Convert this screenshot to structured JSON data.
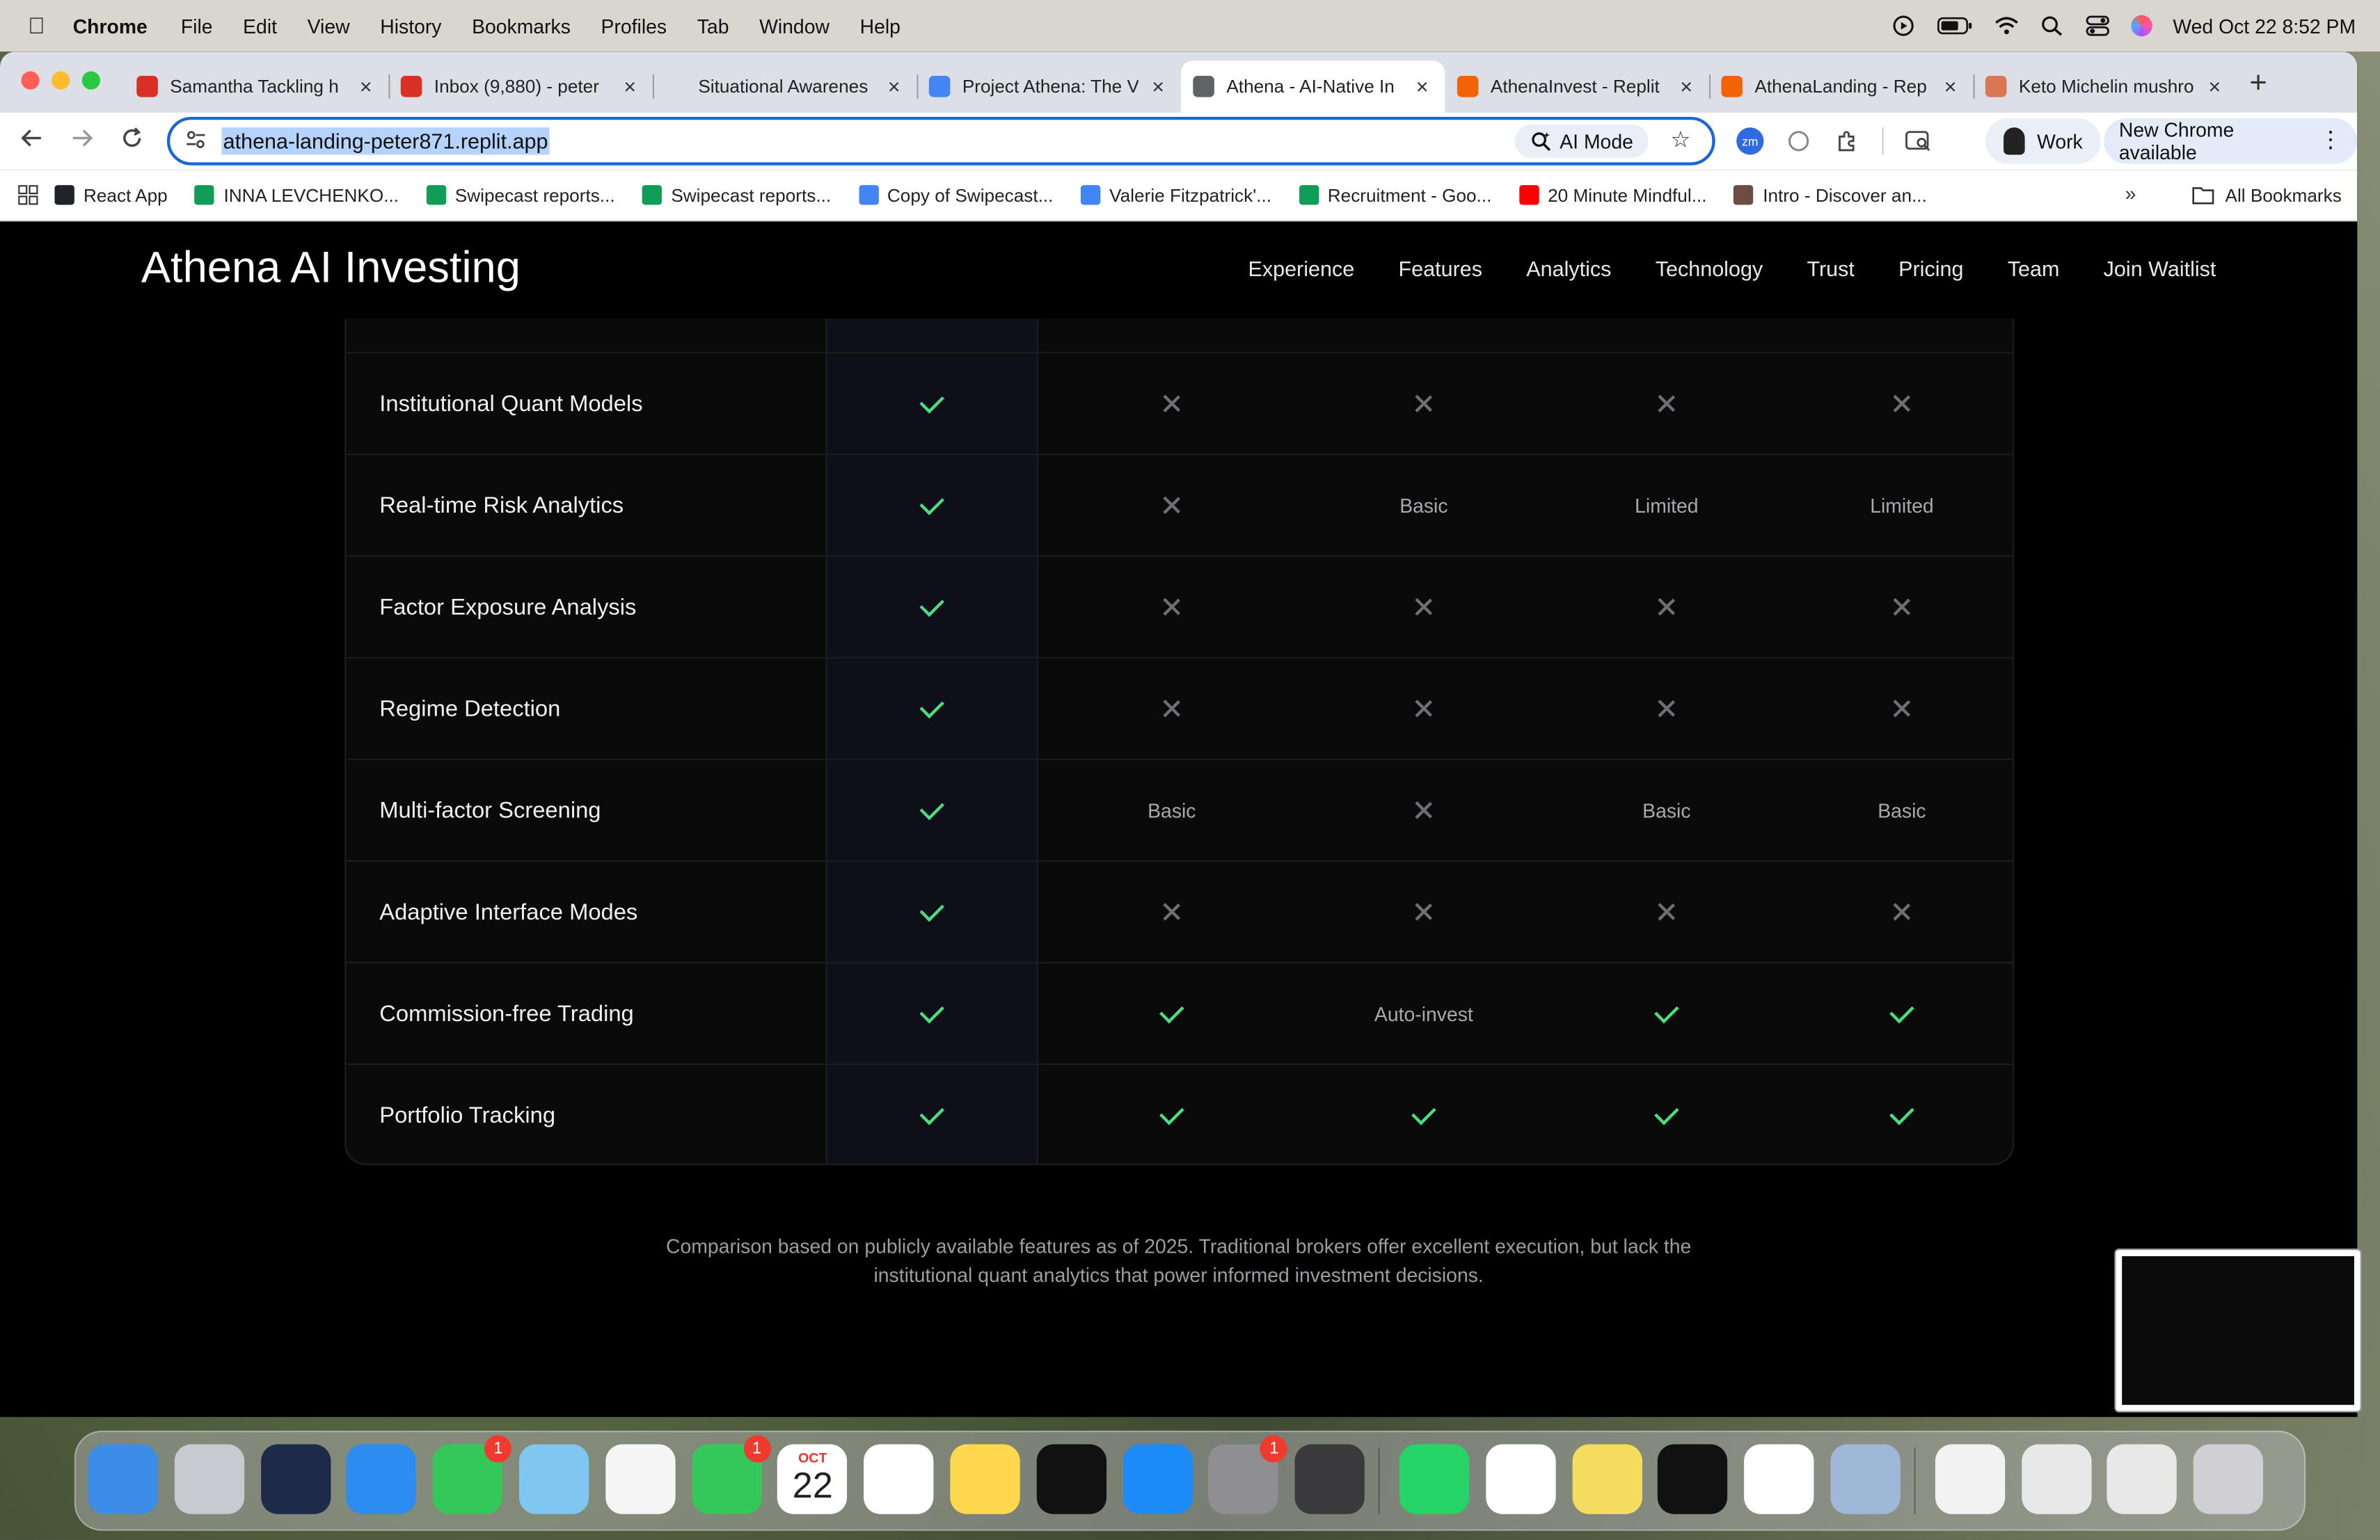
{
  "menubar": {
    "app": "Chrome",
    "items": [
      "File",
      "Edit",
      "View",
      "History",
      "Bookmarks",
      "Profiles",
      "Tab",
      "Window",
      "Help"
    ],
    "datetime": "Wed Oct 22  8:52 PM"
  },
  "tabs": [
    {
      "title": "Samantha Tackling h",
      "color": "#d93025"
    },
    {
      "title": "Inbox (9,880) - peter",
      "color": "#d93025"
    },
    {
      "title": "Situational Awarenes",
      "color": "#dcdfe6"
    },
    {
      "title": "Project Athena: The V",
      "color": "#4285f4"
    },
    {
      "title": "Athena - AI-Native In",
      "color": "#5f6368"
    },
    {
      "title": "AthenaInvest - Replit",
      "color": "#f26207"
    },
    {
      "title": "AthenaLanding - Rep",
      "color": "#f26207"
    },
    {
      "title": "Keto Michelin mushro",
      "color": "#d97757"
    }
  ],
  "active_tab_index": 4,
  "address_bar": {
    "url": "athena-landing-peter871.replit.app",
    "ai_mode": "AI Mode"
  },
  "profile": {
    "label": "Work"
  },
  "update_button": {
    "label": "New Chrome available"
  },
  "bookmarks": [
    {
      "label": "React App",
      "color": "#20232a"
    },
    {
      "label": "INNA LEVCHENKO...",
      "color": "#0f9d58"
    },
    {
      "label": "Swipecast reports...",
      "color": "#0f9d58"
    },
    {
      "label": "Swipecast reports...",
      "color": "#0f9d58"
    },
    {
      "label": "Copy of Swipecast...",
      "color": "#4285f4"
    },
    {
      "label": "Valerie Fitzpatrick'...",
      "color": "#4285f4"
    },
    {
      "label": "Recruitment - Goo...",
      "color": "#0f9d58"
    },
    {
      "label": "20 Minute Mindful...",
      "color": "#ff0000"
    },
    {
      "label": "Intro - Discover an...",
      "color": "#6d4c41"
    }
  ],
  "bookmarks_all": "All Bookmarks",
  "site": {
    "brand": "Athena AI Investing",
    "nav": [
      "Experience",
      "Features",
      "Analytics",
      "Technology",
      "Trust",
      "Pricing",
      "Team",
      "Join Waitlist"
    ]
  },
  "comparison": {
    "rows": [
      {
        "feature": "Institutional Quant Models",
        "cells": [
          "check",
          "x",
          "x",
          "x",
          "x"
        ]
      },
      {
        "feature": "Real-time Risk Analytics",
        "cells": [
          "check",
          "x",
          "Basic",
          "Limited",
          "Limited"
        ]
      },
      {
        "feature": "Factor Exposure Analysis",
        "cells": [
          "check",
          "x",
          "x",
          "x",
          "x"
        ]
      },
      {
        "feature": "Regime Detection",
        "cells": [
          "check",
          "x",
          "x",
          "x",
          "x"
        ]
      },
      {
        "feature": "Multi-factor Screening",
        "cells": [
          "check",
          "Basic",
          "x",
          "Basic",
          "Basic"
        ]
      },
      {
        "feature": "Adaptive Interface Modes",
        "cells": [
          "check",
          "x",
          "x",
          "x",
          "x"
        ]
      },
      {
        "feature": "Commission-free Trading",
        "cells": [
          "check",
          "check",
          "Auto-invest",
          "check",
          "check"
        ]
      },
      {
        "feature": "Portfolio Tracking",
        "cells": [
          "check",
          "check",
          "check",
          "check",
          "check"
        ]
      }
    ],
    "footnote": "Comparison based on publicly available features as of 2025. Traditional brokers offer excellent execution, but lack the institutional quant analytics that power informed investment decisions."
  },
  "dock": {
    "apps": [
      {
        "name": "finder-icon",
        "color": "#3b8de8"
      },
      {
        "name": "launchpad-icon",
        "color": "#c9c9d0"
      },
      {
        "name": "copilot-icon",
        "color": "#1e2a4a"
      },
      {
        "name": "safari-icon",
        "color": "#2d8cf0"
      },
      {
        "name": "messages-icon",
        "color": "#34c759",
        "badge": "1"
      },
      {
        "name": "maps-icon",
        "color": "#7fc6f0"
      },
      {
        "name": "photos-icon",
        "color": "#f5f5f5"
      },
      {
        "name": "facetime-icon",
        "color": "#34c759",
        "badge": "1"
      },
      {
        "name": "calendar-icon",
        "color": "#ffffff",
        "month": "OCT",
        "day": "22"
      },
      {
        "name": "reminders-icon",
        "color": "#ffffff"
      },
      {
        "name": "notes-icon",
        "color": "#ffd84d"
      },
      {
        "name": "appletv-icon",
        "color": "#111111"
      },
      {
        "name": "appstore-icon",
        "color": "#1d8cf8"
      },
      {
        "name": "settings-icon",
        "color": "#8e8e93",
        "badge": "1"
      },
      {
        "name": "iphone-mirroring-icon",
        "color": "#3a3a3c"
      },
      {
        "name": "whatsapp-icon",
        "color": "#25d366"
      },
      {
        "name": "slack-icon",
        "color": "#ffffff"
      },
      {
        "name": "stickies-icon",
        "color": "#f5dc5c"
      },
      {
        "name": "spotify-icon",
        "color": "#111111"
      },
      {
        "name": "chrome-icon",
        "color": "#ffffff"
      },
      {
        "name": "preview-icon",
        "color": "#9fb8d8"
      },
      {
        "name": "document-icon",
        "color": "#f2f2f2"
      },
      {
        "name": "window-thumb-icon",
        "color": "#e8e8e8"
      },
      {
        "name": "window-thumb-icon",
        "color": "#e8e8e8"
      },
      {
        "name": "trash-icon",
        "color": "#d0d0d4"
      }
    ]
  }
}
